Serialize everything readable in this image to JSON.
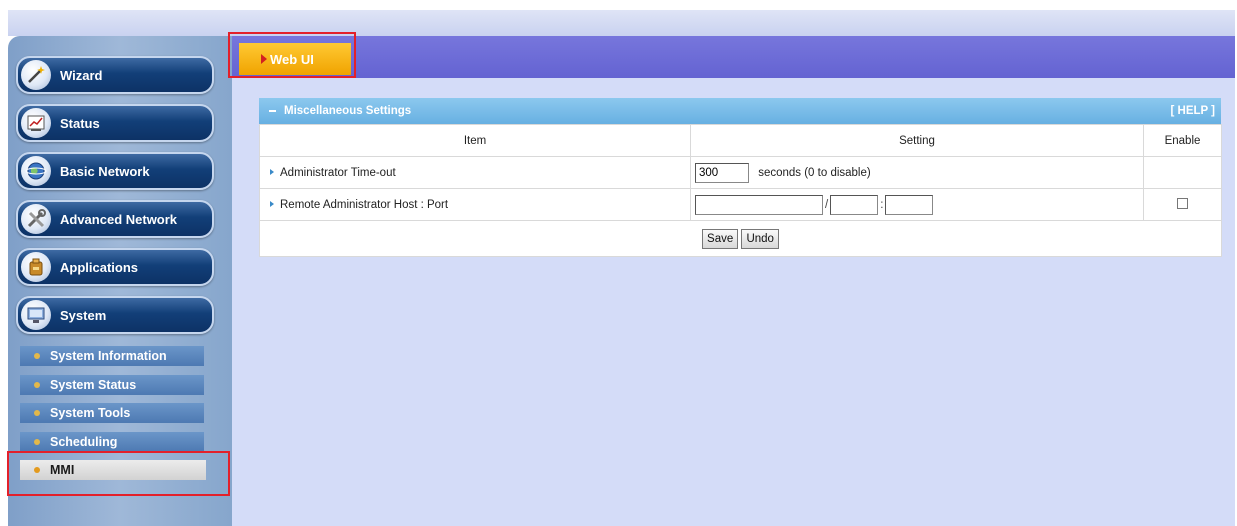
{
  "sidebar": {
    "nav": [
      {
        "label": "Wizard",
        "icon": "wand-icon"
      },
      {
        "label": "Status",
        "icon": "chart-icon"
      },
      {
        "label": "Basic Network",
        "icon": "globe-icon"
      },
      {
        "label": "Advanced Network",
        "icon": "tools-icon"
      },
      {
        "label": "Applications",
        "icon": "package-icon"
      },
      {
        "label": "System",
        "icon": "computer-icon"
      }
    ],
    "system_submenu": [
      {
        "label": "System Information"
      },
      {
        "label": "System Status"
      },
      {
        "label": "System Tools"
      },
      {
        "label": "Scheduling"
      },
      {
        "label": "MMI",
        "active": true
      }
    ]
  },
  "tab": {
    "label": "Web UI"
  },
  "panel": {
    "title": "Miscellaneous Settings",
    "help": "[ HELP ]",
    "columns": {
      "item": "Item",
      "setting": "Setting",
      "enable": "Enable"
    },
    "rows": {
      "timeout": {
        "label": "Administrator Time-out",
        "value": "300",
        "hint": "seconds (0 to disable)"
      },
      "remote": {
        "label": "Remote Administrator Host : Port",
        "host": "",
        "mask": "",
        "port": "",
        "sep_slash": "/",
        "sep_colon": ":",
        "enabled": false
      }
    },
    "buttons": {
      "save": "Save",
      "undo": "Undo"
    }
  },
  "colors": {
    "sidebar_button": "#123f78",
    "tab_band": "#6d6cd8",
    "tab_active": "#f7b21a",
    "panel_header": "#78bce8",
    "page_background": "#d4dcf8",
    "highlight_box": "#e3202a"
  }
}
